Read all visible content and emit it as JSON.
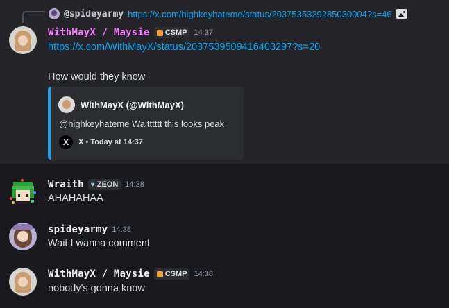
{
  "reply": {
    "username": "@spideyarmy",
    "link": "https://x.com/highkeyhateme/status/2037535329285030004?s=46"
  },
  "messages": [
    {
      "author": "WithMayX / Maysie",
      "badge": "CSMP",
      "time": "14:37",
      "link": "https://x.com/WithMayX/status/2037539509416403297?s=20",
      "text": "How would they know",
      "embed": {
        "author": "WithMayX (@WithMayX)",
        "body": "@highkeyhateme Waitttttt this looks peak",
        "footer": "X • Today at 14:37"
      }
    },
    {
      "author": "Wraith",
      "badge": "ZEON",
      "time": "14:38",
      "text": "AHAHAHAA"
    },
    {
      "author": "spideyarmy",
      "time": "14:38",
      "text": "Wait I wanna comment"
    },
    {
      "author": "WithMayX / Maysie",
      "badge": "CSMP",
      "time": "14:38",
      "text": "nobody's gonna know"
    }
  ],
  "colors": {
    "maysie": "#f47fff",
    "default_name": "#f2f3f5",
    "link": "#00a8fc",
    "embed_bar": "#1da1f2",
    "highlight_bg": "#242429"
  }
}
